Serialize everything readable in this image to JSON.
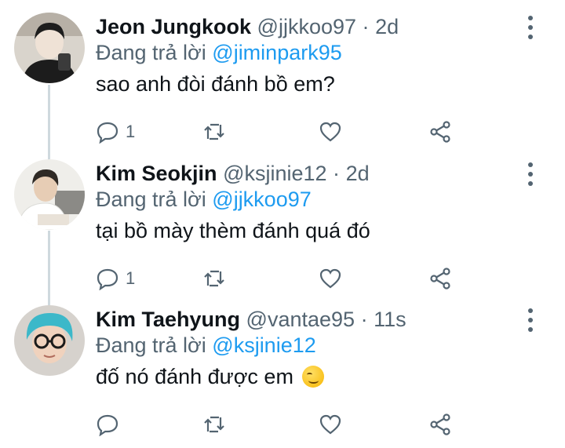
{
  "replying_prefix": "Đang trả lời",
  "tweets": [
    {
      "display_name": "Jeon Jungkook",
      "handle": "@jjkkoo97",
      "separator": "·",
      "time": "2d",
      "reply_to": "@jiminpark95",
      "text": "sao anh đòi đánh bồ em?",
      "reply_count": "1",
      "avatar_colors": [
        "#2a2a2a",
        "#cfc6bd"
      ],
      "emoji": ""
    },
    {
      "display_name": "Kim Seokjin",
      "handle": "@ksjinie12",
      "separator": "·",
      "time": "2d",
      "reply_to": "@jjkkoo97",
      "text": "tại bồ mày thèm đánh quá đó",
      "reply_count": "1",
      "avatar_colors": [
        "#f4f4f0",
        "#3a342e"
      ],
      "emoji": ""
    },
    {
      "display_name": "Kim Taehyung",
      "handle": "@vantae95",
      "separator": "·",
      "time": "11s",
      "reply_to": "@ksjinie12",
      "text": "đố nó đánh được em",
      "reply_count": "",
      "avatar_colors": [
        "#3fb7c8",
        "#e8c2a8"
      ],
      "emoji": "smirking-face"
    }
  ],
  "icons": {
    "reply": "reply-icon",
    "retweet": "retweet-icon",
    "like": "like-icon",
    "share": "share-icon",
    "more": "more-vertical-icon"
  },
  "colors": {
    "text_primary": "#0f1419",
    "text_secondary": "#536471",
    "mention": "#1d9bf0",
    "thread_line": "#cfd9de"
  }
}
